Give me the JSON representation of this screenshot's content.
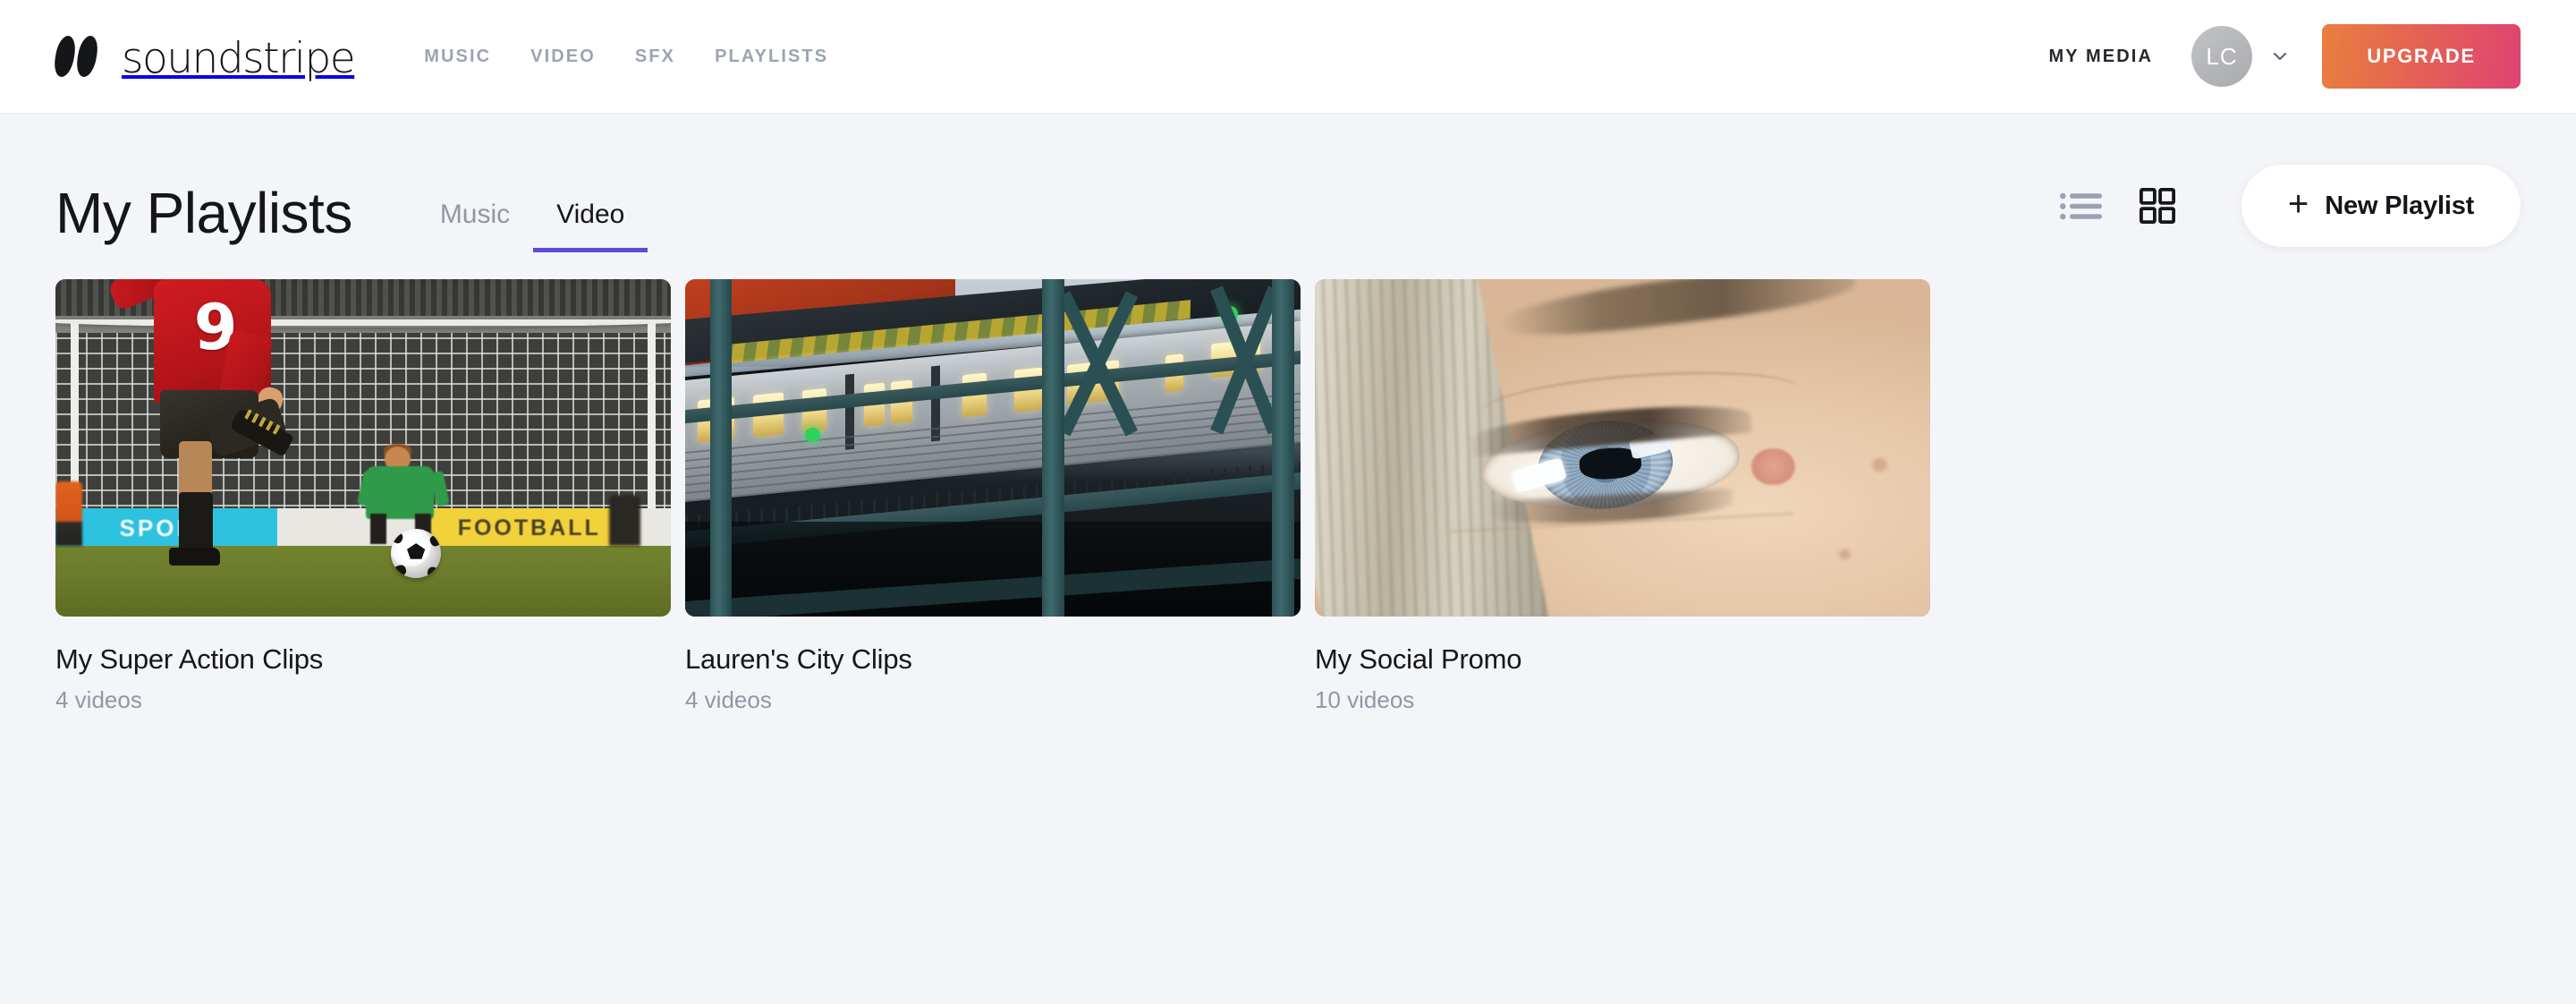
{
  "header": {
    "brand": "soundstripe",
    "nav": [
      {
        "label": "MUSIC"
      },
      {
        "label": "VIDEO"
      },
      {
        "label": "SFX"
      },
      {
        "label": "PLAYLISTS"
      }
    ],
    "my_media": "MY MEDIA",
    "avatar_initials": "LC",
    "upgrade_label": "UPGRADE",
    "colors": {
      "nav_link": "#9ba3b4",
      "my_media": "#26282d",
      "upgrade_gradient_start": "#e97f3e",
      "upgrade_gradient_end": "#e04272"
    }
  },
  "page": {
    "title": "My Playlists",
    "tabs": [
      {
        "label": "Music",
        "active": false
      },
      {
        "label": "Video",
        "active": true
      }
    ],
    "active_tab": "Video",
    "tab_underline_color": "#5b4ddb",
    "view_modes": [
      {
        "name": "list-view",
        "active": false
      },
      {
        "name": "grid-view",
        "active": true
      }
    ],
    "new_playlist_label": "New Playlist",
    "new_playlist_plus": "+"
  },
  "playlists": [
    {
      "title": "My Super Action Clips",
      "count": "4 videos",
      "thumbnail": "soccer-penalty-kick",
      "thumb_text": {
        "ad_left": "SPORT",
        "ad_right": "FOOTBALL",
        "jersey_number": "9"
      }
    },
    {
      "title": "Lauren's City Clips",
      "count": "4 videos",
      "thumbnail": "elevated-subway-train"
    },
    {
      "title": "My Social Promo",
      "count": "10 videos",
      "thumbnail": "close-up-blue-eye"
    }
  ]
}
